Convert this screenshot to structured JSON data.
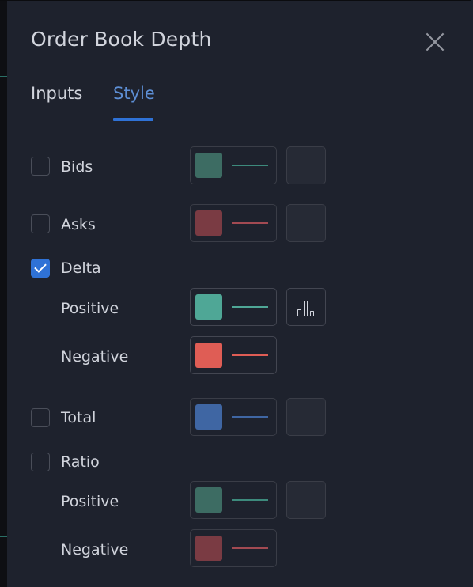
{
  "dialog": {
    "title": "Order Book Depth",
    "tabs": [
      {
        "label": "Inputs",
        "active": false
      },
      {
        "label": "Style",
        "active": true
      }
    ]
  },
  "rows": {
    "bids": {
      "label": "Bids",
      "checked": false,
      "color": "#3d6c63",
      "line_color": "#3d8a7c"
    },
    "asks": {
      "label": "Asks",
      "checked": false,
      "color": "#7a3b43",
      "line_color": "#a24a52"
    },
    "delta": {
      "label": "Delta",
      "checked": true
    },
    "delta_positive": {
      "label": "Positive",
      "color": "#4fa796",
      "line_color": "#4fa796"
    },
    "delta_negative": {
      "label": "Negative",
      "color": "#df5d55",
      "line_color": "#df5d55"
    },
    "total": {
      "label": "Total",
      "checked": false,
      "color": "#3f66a3",
      "line_color": "#3f66a3"
    },
    "ratio": {
      "label": "Ratio",
      "checked": false
    },
    "ratio_positive": {
      "label": "Positive",
      "color": "#3d6c63",
      "line_color": "#3d8a7c"
    },
    "ratio_negative": {
      "label": "Negative",
      "color": "#7a3b43",
      "line_color": "#a24a52"
    }
  },
  "icons": {
    "close": "close-icon",
    "plot_style": "bar-chart-icon"
  }
}
